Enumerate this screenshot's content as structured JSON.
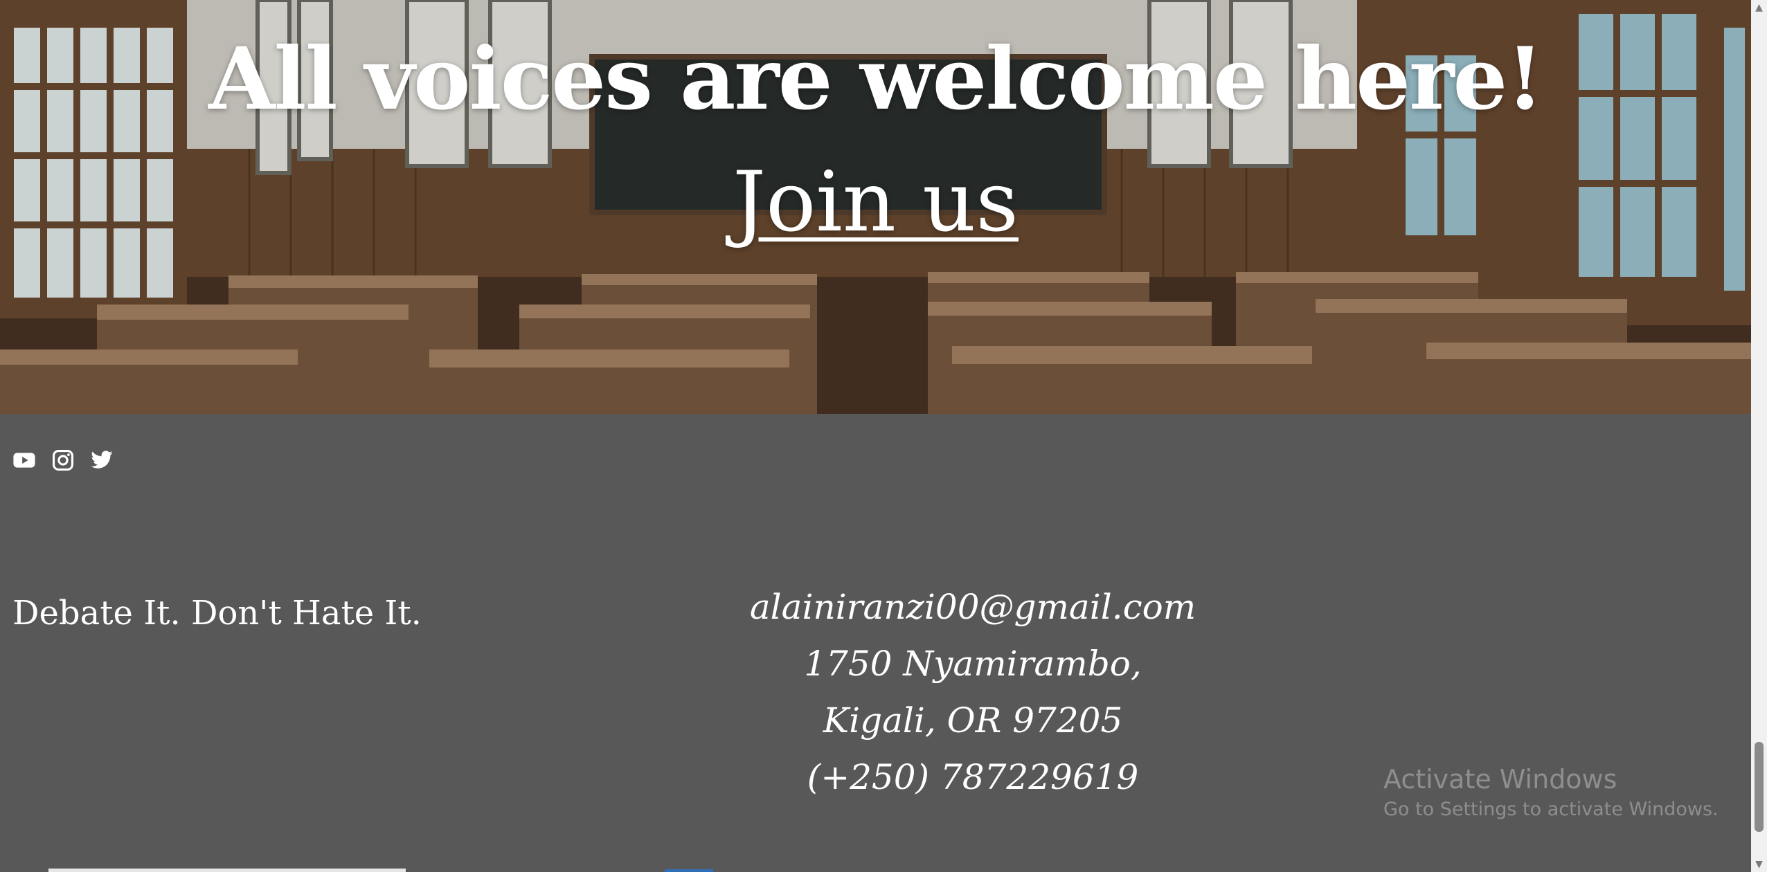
{
  "hero": {
    "title": "All voices are welcome here!",
    "cta_link": "Join us"
  },
  "footer": {
    "social_icons": [
      "youtube-icon",
      "instagram-icon",
      "twitter-icon"
    ],
    "tagline": "Debate It. Don't Hate It.",
    "contact": {
      "email": "alainiranzi00@gmail.com",
      "address_line1": "1750 Nyamirambo,",
      "address_line2": "Kigali, OR 97205",
      "phone": "(+250) 787229619"
    }
  },
  "windows_watermark": {
    "title": "Activate Windows",
    "subtitle": "Go to Settings to activate Windows."
  },
  "colors": {
    "footer_bg": "#585858",
    "text": "#ffffff",
    "watermark": "#8e8e8e"
  }
}
